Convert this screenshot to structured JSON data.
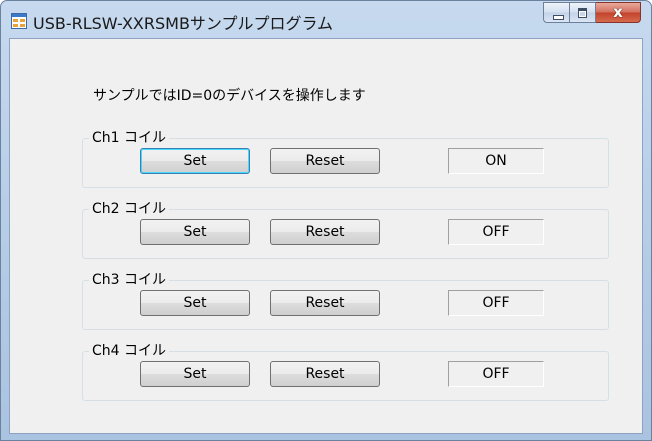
{
  "window": {
    "title": "USB-RLSW-XXRSMBサンプルプログラム",
    "caption_buttons": {
      "minimize_icon": "minimize-icon",
      "maximize_icon": "maximize-icon",
      "close_glyph": "x"
    }
  },
  "main": {
    "description": "サンプルではID=0のデバイスを操作します",
    "channels": [
      {
        "label": "Ch1 コイル",
        "set_label": "Set",
        "reset_label": "Reset",
        "status": "ON"
      },
      {
        "label": "Ch2 コイル",
        "set_label": "Set",
        "reset_label": "Reset",
        "status": "OFF"
      },
      {
        "label": "Ch3 コイル",
        "set_label": "Set",
        "reset_label": "Reset",
        "status": "OFF"
      },
      {
        "label": "Ch4 コイル",
        "set_label": "Set",
        "reset_label": "Reset",
        "status": "OFF"
      }
    ]
  },
  "colors": {
    "titlebar": "#b4cbe6",
    "client_background": "#f0f0f0",
    "close_button": "#c2422b"
  }
}
